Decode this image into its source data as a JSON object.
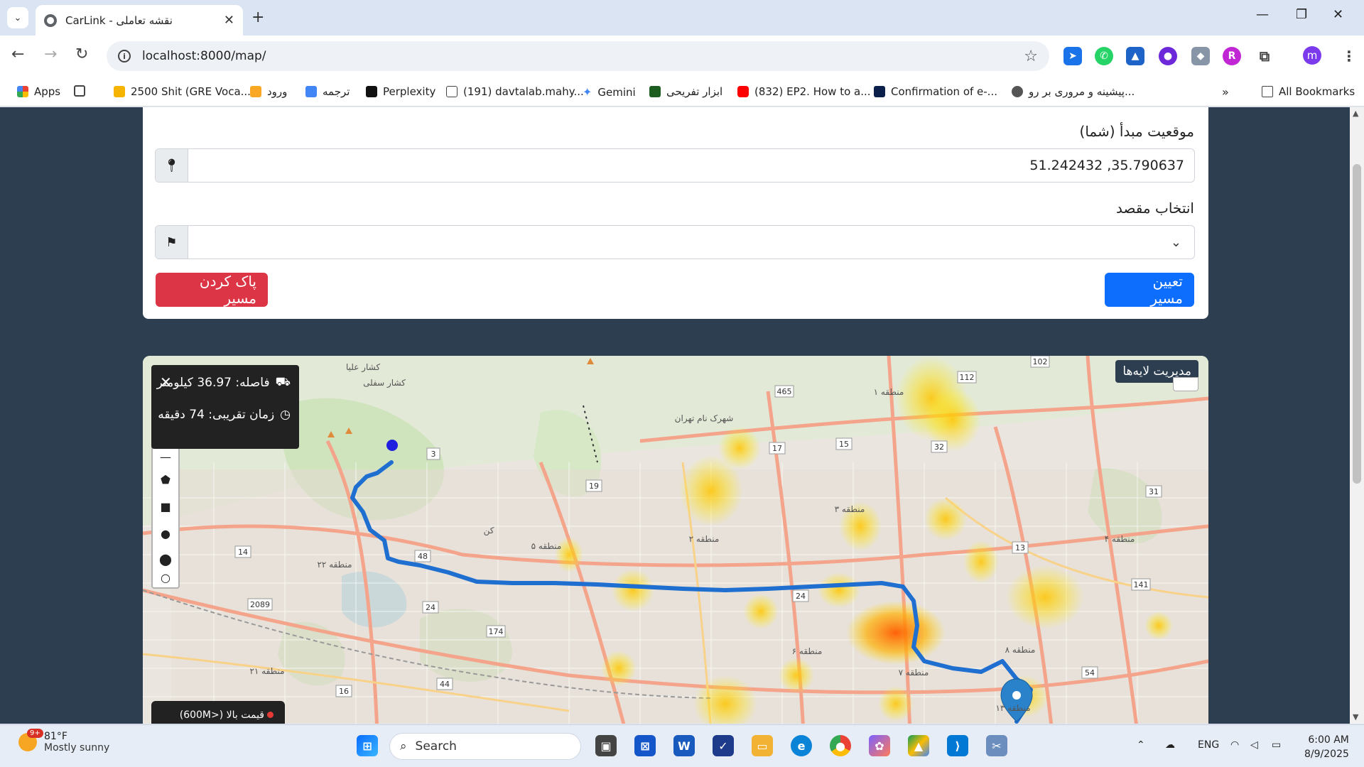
{
  "browser": {
    "tab_title": "CarLink - نقشه تعاملی",
    "url": "localhost:8000/map/",
    "bookmarks": [
      "Apps",
      "2500 Shit (GRE Voca...",
      "ورود",
      "ترجمه",
      "Perplexity",
      "(191) davtalab.mahy...",
      "Gemini",
      "ابزار تفریحی",
      "(832) EP2. How to a...",
      "Confirmation of e-...",
      "پیشینه و مروری بر رو...",
      "All Bookmarks"
    ],
    "profile_initial": "m"
  },
  "form": {
    "origin_label": "موقعیت مبدأ (شما)",
    "origin_value": "51.242432 ,35.790637",
    "destination_label": "انتخاب مقصد",
    "route_button": "تعیین مسیر",
    "clear_button": "پاک کردن مسیر"
  },
  "map": {
    "layers_button": "مدیریت لایه‌ها",
    "distance": "فاصله: 36.97 کیلومتر",
    "duration": "زمان تقریبی: 74 دقیقه",
    "legend_text": "قیمت بالا (<600M)",
    "labels": [
      "کشار علیا",
      "کشار سفلی",
      "شهرک نام تهران",
      "منطقه ۱",
      "منطقه ۲",
      "منطقه ۳",
      "منطقه ۴",
      "منطقه ۵",
      "منطقه ۶",
      "منطقه ۷",
      "منطقه ۸",
      "منطقه ۲۲",
      "منطقه ۲۱",
      "منطقه ۱۳",
      "کن"
    ],
    "road_numbers": [
      "102",
      "112",
      "465",
      "17",
      "15",
      "32",
      "3",
      "19",
      "31",
      "14",
      "48",
      "13",
      "24",
      "141",
      "2089",
      "24",
      "174",
      "54",
      "16",
      "44"
    ],
    "colors": {
      "route": "#1f6fd1",
      "heat_hot": "#ff6a00",
      "heat_warm": "#ffd21a"
    }
  },
  "taskbar": {
    "weather_temp": "81°F",
    "weather_desc": "Mostly sunny",
    "weather_badge": "9+",
    "search_label": "Search",
    "lang": "ENG",
    "time": "6:00 AM",
    "date": "8/9/2025"
  }
}
